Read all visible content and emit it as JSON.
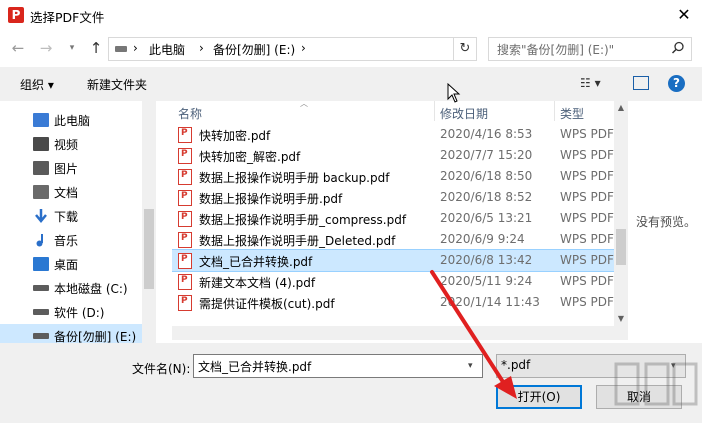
{
  "window": {
    "title": "选择PDF文件",
    "close_glyph": "✕",
    "app_icon_letter": "P"
  },
  "nav": {
    "back": "←",
    "forward": "→",
    "dropdown": "▾",
    "up": "↑",
    "breadcrumbs": [
      "›",
      "此电脑",
      "›",
      "备份[勿删] (E:)",
      "›"
    ],
    "refresh": "↻",
    "search_placeholder": "搜索\"备份[勿删] (E:)\""
  },
  "toolbar": {
    "organize": "组织 ▾",
    "new_folder": "新建文件夹",
    "view": "☷ ▾",
    "help": "?"
  },
  "sidebar": {
    "items": [
      {
        "label": "此电脑",
        "icon": "computer-icon"
      },
      {
        "label": "视频",
        "icon": "video-icon"
      },
      {
        "label": "图片",
        "icon": "pictures-icon"
      },
      {
        "label": "文档",
        "icon": "documents-icon"
      },
      {
        "label": "下载",
        "icon": "download-icon"
      },
      {
        "label": "音乐",
        "icon": "music-icon"
      },
      {
        "label": "桌面",
        "icon": "desktop-icon"
      },
      {
        "label": "本地磁盘 (C:)",
        "icon": "drive-icon"
      },
      {
        "label": "软件 (D:)",
        "icon": "drive-icon"
      },
      {
        "label": "备份[勿删] (E:)",
        "icon": "drive-icon",
        "selected": true
      }
    ]
  },
  "filelist": {
    "columns": {
      "name": "名称",
      "date": "修改日期",
      "type": "类型"
    },
    "rows": [
      {
        "name": "快转加密.pdf",
        "date": "2020/4/16 8:53",
        "type": "WPS PDF"
      },
      {
        "name": "快转加密_解密.pdf",
        "date": "2020/7/7 15:20",
        "type": "WPS PDF"
      },
      {
        "name": "数据上报操作说明手册 backup.pdf",
        "date": "2020/6/18 8:50",
        "type": "WPS PDF"
      },
      {
        "name": "数据上报操作说明手册.pdf",
        "date": "2020/6/18 8:52",
        "type": "WPS PDF"
      },
      {
        "name": "数据上报操作说明手册_compress.pdf",
        "date": "2020/6/5 13:21",
        "type": "WPS PDF"
      },
      {
        "name": "数据上报操作说明手册_Deleted.pdf",
        "date": "2020/6/9 9:24",
        "type": "WPS PDF"
      },
      {
        "name": "文档_已合并转换.pdf",
        "date": "2020/6/8 13:42",
        "type": "WPS PDF",
        "selected": true
      },
      {
        "name": "新建文本文档 (4).pdf",
        "date": "2020/5/11 9:24",
        "type": "WPS PDF"
      },
      {
        "name": "需提供证件模板(cut).pdf",
        "date": "2020/1/14 11:43",
        "type": "WPS PDF"
      }
    ]
  },
  "preview": {
    "text": "没有预览。"
  },
  "bottom": {
    "filename_label": "文件名(N):",
    "filename_value": "文档_已合并转换.pdf",
    "filter_value": "*.pdf",
    "open_label": "打开(O)",
    "cancel_label": "取消"
  },
  "colors": {
    "accent": "#0078d7",
    "selection": "#cce8ff",
    "annotation": "#e02020"
  }
}
